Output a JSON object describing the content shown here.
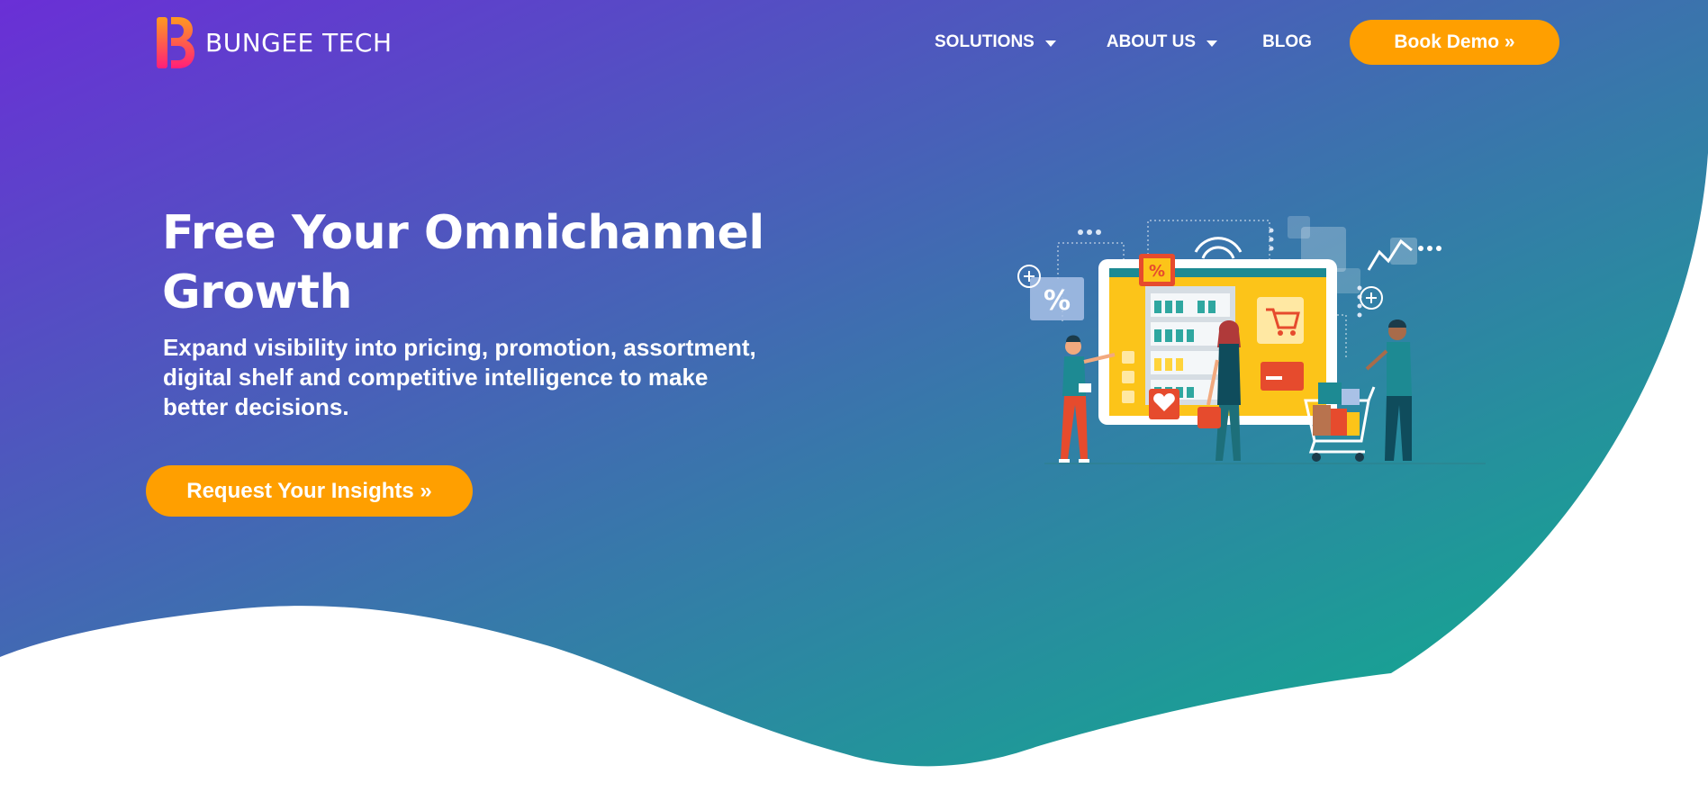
{
  "brand": {
    "name": "BUNGEE TECH",
    "colors": {
      "gradient_start": "#6a2fd6",
      "gradient_end": "#0bb38a",
      "accent": "#ff9f00",
      "logo_gradient_top": "#ff9a1f",
      "logo_gradient_bottom": "#ff1f7a"
    }
  },
  "nav": {
    "items": [
      {
        "label": "SOLUTIONS",
        "has_dropdown": true
      },
      {
        "label": "ABOUT US",
        "has_dropdown": true
      },
      {
        "label": "BLOG",
        "has_dropdown": false
      }
    ],
    "cta_label": "Book Demo »"
  },
  "hero": {
    "title": "Free Your Omnichannel Growth",
    "subtitle": "Expand visibility into pricing, promotion, assortment, digital shelf and competitive intelligence to make better decisions.",
    "cta_label": "Request Your Insights »",
    "illustration_icon": "omnichannel-shopping-illustration"
  }
}
